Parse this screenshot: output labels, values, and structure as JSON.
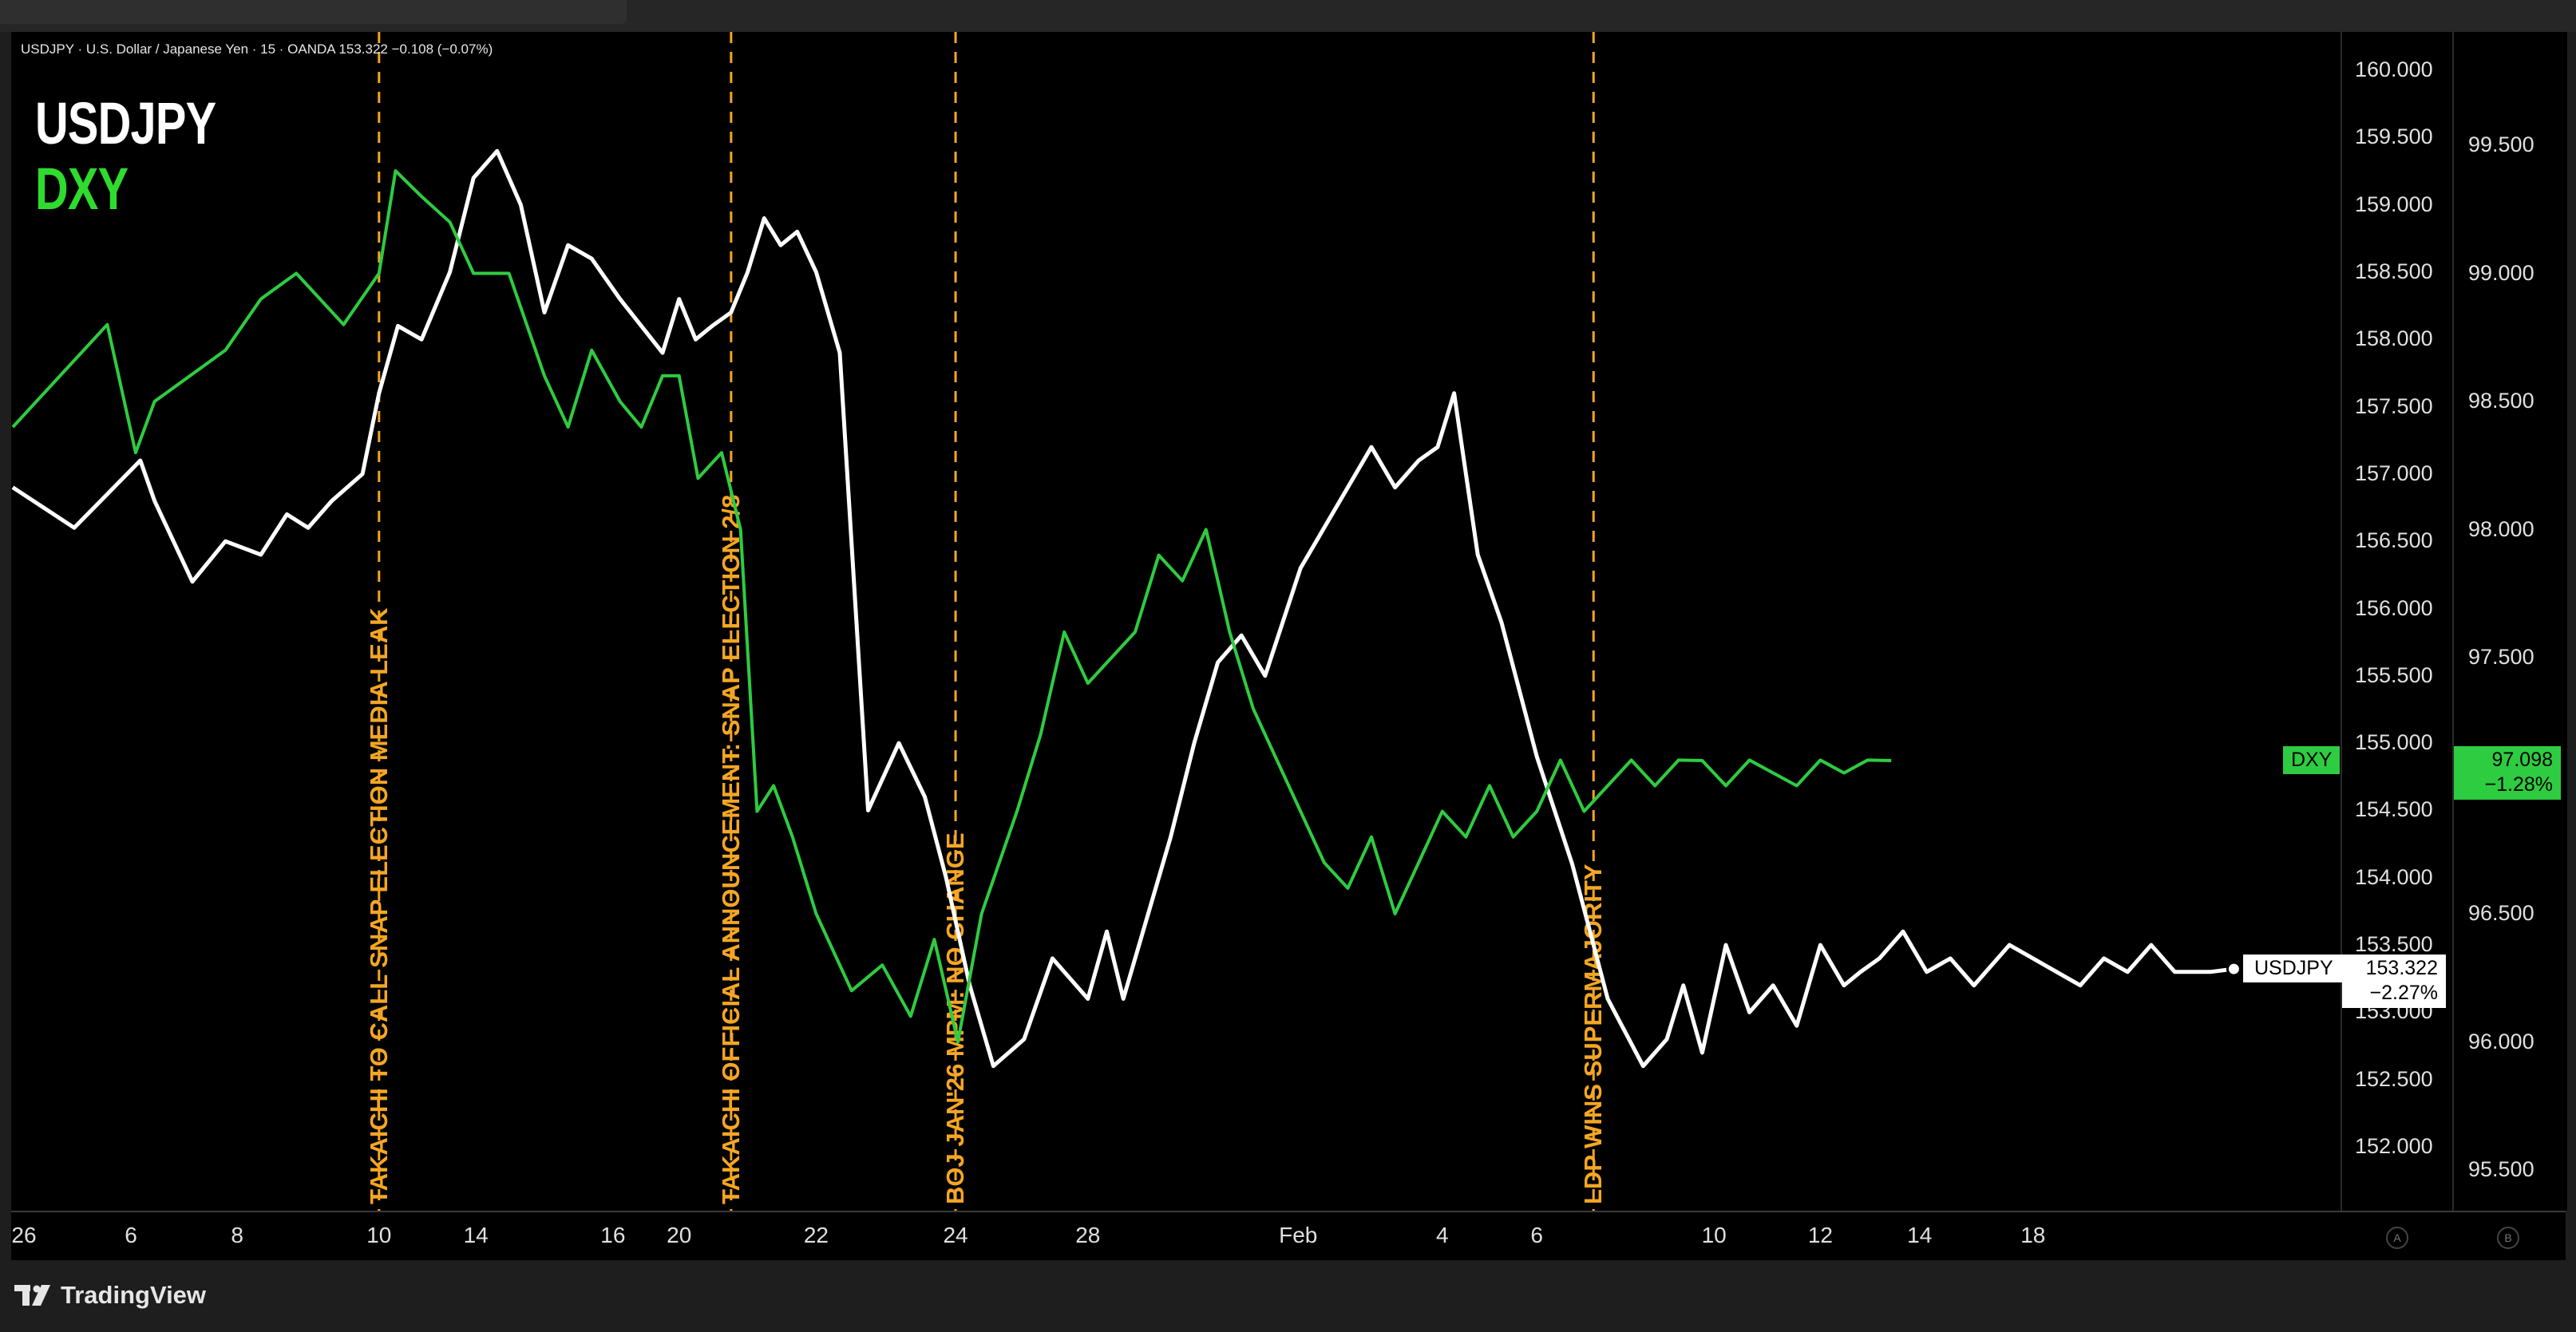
{
  "legend": {
    "text": "USDJPY · U.S. Dollar / Japanese Yen · 15 · OANDA  153.322  −0.108 (−0.07%)"
  },
  "titles": {
    "usdjpy": "USDJPY",
    "dxy": "DXY"
  },
  "footer": {
    "brand": "TradingView"
  },
  "buttons": {
    "a": "A",
    "b": "B"
  },
  "colors": {
    "usdjpy": "#ffffff",
    "dxy": "#2ecc40",
    "event_line": "#f5a623",
    "background": "#000000"
  },
  "chart_data": {
    "type": "line",
    "x_unit": "15-minute bars, Jan 2026 – Feb 2026",
    "x_ticks": [
      "26",
      "6",
      "8",
      "10",
      "14",
      "16",
      "20",
      "22",
      "24",
      "28",
      "Feb",
      "4",
      "6",
      "10",
      "12",
      "14",
      "18"
    ],
    "y_axis_usdjpy": {
      "ticks": [
        "160.000",
        "159.500",
        "159.000",
        "158.500",
        "158.000",
        "157.500",
        "157.000",
        "156.500",
        "156.000",
        "155.500",
        "155.000",
        "154.500",
        "154.000",
        "153.500",
        "153.000",
        "152.500",
        "152.000"
      ],
      "ylim": [
        151.95,
        160.05
      ]
    },
    "y_axis_dxy": {
      "ticks": [
        "99.500",
        "99.000",
        "98.500",
        "98.000",
        "97.500",
        "97.000",
        "96.500",
        "96.000",
        "95.500"
      ],
      "ylim": [
        95.4,
        99.75
      ]
    },
    "series": [
      {
        "name": "USDJPY",
        "axis": "left",
        "x": [
          0,
          2.6,
          5.4,
          6,
          7.6,
          9,
          10.5,
          11.6,
          12.5,
          13.5,
          14.8,
          15.5,
          16.3,
          17.3,
          18.5,
          19.5,
          20.5,
          21.5,
          22.5,
          23.5,
          24.5,
          25.7,
          26.6,
          27.5,
          28.2,
          28.9,
          29.6,
          30.4,
          31.1,
          31.8,
          32.5,
          33.2,
          34,
          35,
          36.2,
          37.5,
          38.6,
          39.5,
          40.5,
          41.5,
          42.8,
          44,
          45.5,
          46.3,
          47,
          48,
          49,
          50,
          51,
          52,
          53,
          54.5,
          55.5,
          56.5,
          57.5,
          58.5,
          59.5,
          60.3,
          61,
          62,
          63,
          64.5,
          66,
          67.5,
          69,
          70,
          70.7,
          71.5,
          72.5,
          73.5,
          74.5,
          75.5,
          76.5,
          77.5,
          78.2,
          79,
          80,
          81,
          82,
          83,
          84.5,
          85.5,
          86.5,
          87.5,
          88.5,
          89.5,
          90.5,
          91.5,
          92.5,
          93,
          94
        ],
        "y": [
          156.9,
          156.6,
          157.1,
          156.8,
          156.2,
          156.5,
          156.4,
          156.7,
          156.6,
          156.8,
          157.0,
          157.6,
          158.1,
          158.0,
          158.5,
          159.2,
          159.4,
          159.0,
          158.2,
          158.7,
          158.6,
          158.3,
          158.1,
          157.9,
          158.3,
          158.0,
          158.1,
          158.2,
          158.5,
          158.9,
          158.7,
          158.8,
          158.5,
          157.9,
          154.5,
          155.0,
          154.6,
          154.0,
          153.2,
          152.6,
          152.8,
          153.4,
          153.1,
          153.6,
          153.1,
          153.7,
          154.3,
          155.0,
          155.6,
          155.8,
          155.5,
          156.3,
          156.6,
          156.9,
          157.2,
          156.9,
          157.1,
          157.2,
          157.6,
          156.4,
          155.9,
          154.9,
          154.1,
          153.1,
          152.6,
          152.8,
          153.2,
          152.7,
          153.5,
          153.0,
          153.2,
          152.9,
          153.5,
          153.2,
          153.3,
          153.4,
          153.6,
          153.3,
          153.4,
          153.2,
          153.5,
          153.4,
          153.3,
          153.2,
          153.4,
          153.3,
          153.5,
          153.3,
          153.3,
          153.3,
          153.322
        ]
      },
      {
        "name": "DXY",
        "axis": "right",
        "x": [
          0,
          2,
          4,
          5.2,
          6,
          7.5,
          9,
          10.5,
          12,
          14,
          15.5,
          16.2,
          17.3,
          18.5,
          19.5,
          21,
          22.5,
          23.5,
          24.5,
          25.7,
          26.6,
          27.5,
          28.2,
          29,
          30,
          30.8,
          31.5,
          32.2,
          33,
          34,
          35.5,
          36.8,
          38,
          39,
          40,
          41,
          42.5,
          43.5,
          44.5,
          45.5,
          46.5,
          47.5,
          48.5,
          49.5,
          50.5,
          51.5,
          52.5,
          53.5,
          54.5,
          55.5,
          56.5,
          57.5,
          58.5,
          59.5,
          60.5,
          61.5,
          62.5,
          63.5,
          64.5,
          65.5,
          66.5,
          67.5,
          68.5,
          69.5,
          70.5,
          71.5,
          72.5,
          73.5,
          74.5,
          75.5,
          76.5,
          77.5,
          78.5,
          79.5
        ],
        "y": [
          98.4,
          98.6,
          98.8,
          98.3,
          98.5,
          98.6,
          98.7,
          98.9,
          99.0,
          98.8,
          99.0,
          99.4,
          99.3,
          99.2,
          99.0,
          99.0,
          98.6,
          98.4,
          98.7,
          98.5,
          98.4,
          98.6,
          98.6,
          98.2,
          98.3,
          98.0,
          96.9,
          97.0,
          96.8,
          96.5,
          96.2,
          96.3,
          96.1,
          96.4,
          96.0,
          96.5,
          96.9,
          97.2,
          97.6,
          97.4,
          97.5,
          97.6,
          97.9,
          97.8,
          98.0,
          97.6,
          97.3,
          97.1,
          96.9,
          96.7,
          96.6,
          96.8,
          96.5,
          96.7,
          96.9,
          96.8,
          97.0,
          96.8,
          96.9,
          97.1,
          96.9,
          97.0,
          97.1,
          97.0,
          97.1,
          97.098,
          97.0,
          97.1,
          97.05,
          97.0,
          97.1,
          97.05,
          97.1,
          97.098
        ]
      }
    ],
    "event_lines": [
      {
        "x": 15.5,
        "label": "TAKAICHI TO CALL SNAP ELECTION MEDIA LEAK"
      },
      {
        "x": 30.4,
        "label": "TAKAICHI OFFICIAL ANNOUNCEMENT: SNAP ELECTION 2/8"
      },
      {
        "x": 39.9,
        "label": "BOJ JAN'26 MPM: NO CHANGE"
      },
      {
        "x": 66.9,
        "label": "LDP WINS SUPERMAJORITY"
      }
    ],
    "last_values": {
      "usdjpy": {
        "name": "USDJPY",
        "price": "153.322",
        "change": "−2.27%"
      },
      "dxy": {
        "name": "DXY",
        "price": "97.098",
        "change": "−1.28%"
      }
    },
    "grid": false,
    "legend": "top-left"
  }
}
